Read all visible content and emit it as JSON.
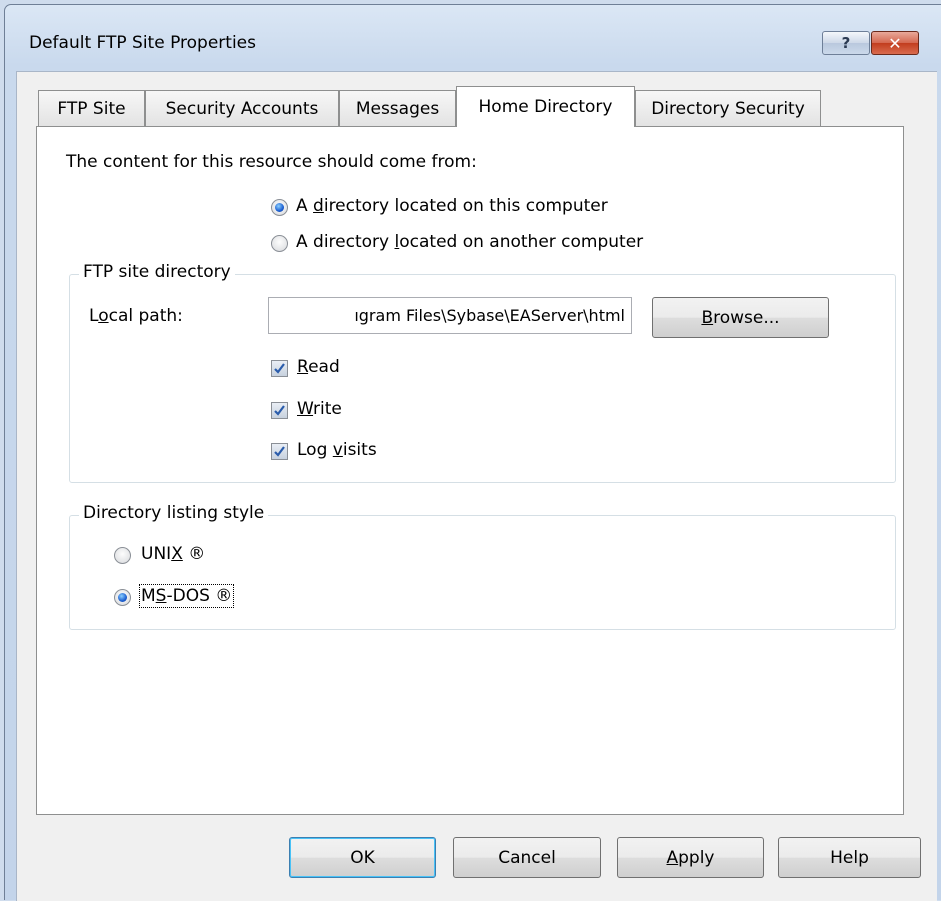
{
  "window": {
    "title": "Default FTP Site Properties",
    "help_glyph": "?",
    "close_glyph": "✕"
  },
  "tabs": [
    {
      "label": "FTP Site",
      "active": false
    },
    {
      "label": "Security Accounts",
      "active": false
    },
    {
      "label": "Messages",
      "active": false
    },
    {
      "label": "Home Directory",
      "active": true
    },
    {
      "label": "Directory Security",
      "active": false
    }
  ],
  "content_source": {
    "prompt": "The content for this resource should come from:",
    "options": [
      {
        "pre": "A ",
        "key": "d",
        "post": "irectory located on this computer",
        "checked": true
      },
      {
        "pre": "A directory ",
        "key": "l",
        "post": "ocated on another computer",
        "checked": false
      }
    ]
  },
  "ftp_directory": {
    "legend": "FTP site directory",
    "local_path_label_pre": "L",
    "local_path_label_key": "o",
    "local_path_label_post": "cal path:",
    "local_path_value": "ıgram Files\\Sybase\\EAServer\\html",
    "browse_key": "B",
    "browse_rest": "rowse...",
    "checks": [
      {
        "pre": "",
        "key": "R",
        "post": "ead",
        "checked": true
      },
      {
        "pre": "",
        "key": "W",
        "post": "rite",
        "checked": true
      },
      {
        "pre": "Log ",
        "key": "v",
        "post": "isits",
        "checked": true
      }
    ]
  },
  "listing_style": {
    "legend": "Directory listing style",
    "options": [
      {
        "pre": "UNI",
        "key": "X",
        "post": " ®",
        "checked": false
      },
      {
        "pre": "M",
        "key": "S",
        "post": "-DOS ®",
        "checked": true
      }
    ]
  },
  "buttons": {
    "ok": "OK",
    "cancel": "Cancel",
    "apply_key": "A",
    "apply_rest": "pply",
    "help": "Help"
  },
  "colors": {
    "accent_radio": "#1c5fd1",
    "check_mark": "#2a5cab"
  }
}
